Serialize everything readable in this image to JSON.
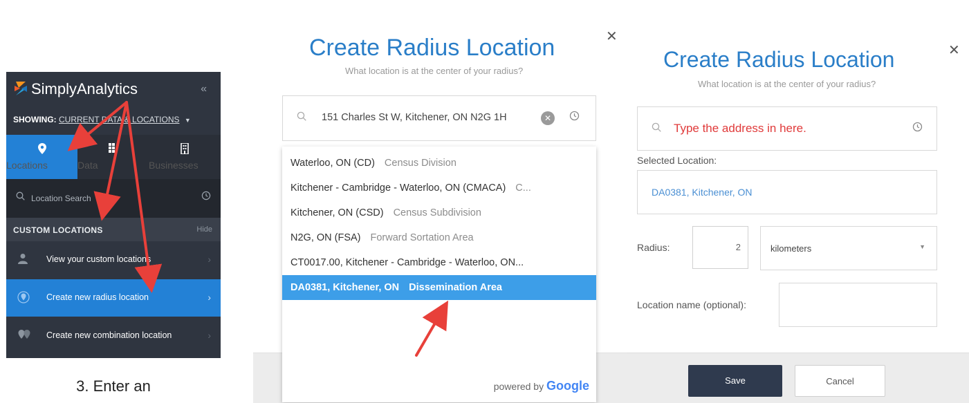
{
  "sidebar": {
    "brand": "SimplyAnalytics",
    "collapse_glyph": "«",
    "showing_prefix": "SHOWING:",
    "showing_value": "CURRENT DATA & LOCATIONS",
    "tabs": [
      {
        "label": "Locations",
        "icon": "map-pin-icon",
        "active": true
      },
      {
        "label": "Data",
        "icon": "grid-icon",
        "active": false
      },
      {
        "label": "Businesses",
        "icon": "building-icon",
        "active": false
      }
    ],
    "search_placeholder": "Location Search",
    "custom_header": "CUSTOM LOCATIONS",
    "custom_hide": "Hide",
    "items": [
      {
        "label": "View your custom locations",
        "icon": "user-icon",
        "active": false
      },
      {
        "label": "Create new radius location",
        "icon": "radius-pin-icon",
        "active": true
      },
      {
        "label": "Create new combination location",
        "icon": "combination-pins-icon",
        "active": false
      }
    ]
  },
  "caption": "3. Enter an",
  "modal_left": {
    "title": "Create Radius Location",
    "subtitle": "What location is at the center of your radius?",
    "search_value": "151 Charles St W, Kitchener, ON N2G 1H",
    "results": [
      {
        "name": "Waterloo, ON (CD)",
        "type": "Census Division",
        "selected": false
      },
      {
        "name": "Kitchener - Cambridge - Waterloo, ON (CMACA)",
        "type": "C...",
        "selected": false
      },
      {
        "name": "Kitchener, ON (CSD)",
        "type": "Census Subdivision",
        "selected": false
      },
      {
        "name": "N2G, ON (FSA)",
        "type": "Forward Sortation Area",
        "selected": false
      },
      {
        "name": "CT0017.00, Kitchener - Cambridge - Waterloo, ON...",
        "type": "",
        "selected": false
      },
      {
        "name": "DA0381, Kitchener, ON",
        "type": "Dissemination Area",
        "selected": true
      }
    ],
    "powered_by": "powered by",
    "google": "Google"
  },
  "modal_right": {
    "title": "Create Radius Location",
    "subtitle": "What location is at the center of your radius?",
    "search_hint": "Type the address in here.",
    "selected_label": "Selected Location:",
    "selected_value": "DA0381, Kitchener, ON",
    "radius_label": "Radius:",
    "radius_value": "2",
    "unit_value": "kilometers",
    "name_label": "Location name (optional):",
    "save_label": "Save",
    "cancel_label": "Cancel"
  },
  "colors": {
    "title_blue": "#2a7ec8",
    "sidebar_bg": "#2f3540",
    "active_blue": "#2381d6",
    "selected_row": "#3d9ee8",
    "annotation_red": "#e03a3a"
  }
}
